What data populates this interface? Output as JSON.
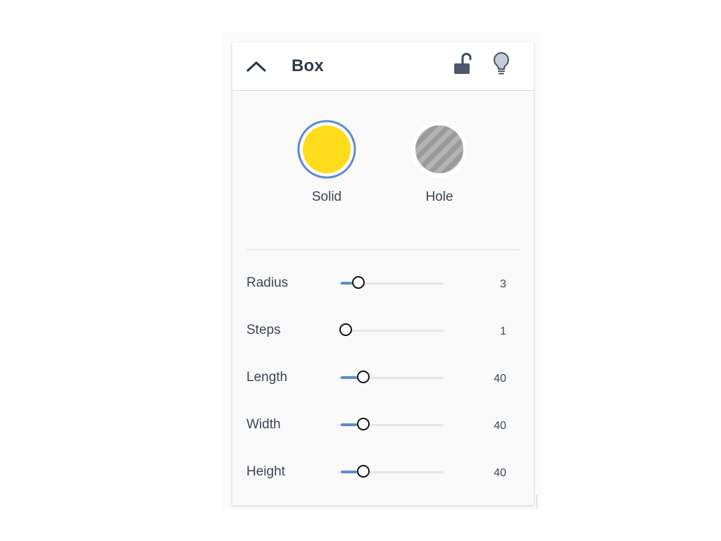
{
  "panel": {
    "title": "Box",
    "icons": {
      "collapse": "chevron-up-icon",
      "lock": "unlock-icon",
      "light": "lightbulb-icon"
    }
  },
  "shape_types": [
    {
      "label": "Solid",
      "selected": true,
      "color": "#ffdc1c"
    },
    {
      "label": "Hole",
      "selected": false,
      "color": "#a8a8a8"
    }
  ],
  "colors": {
    "accent": "#5c8ccf",
    "title": "#2b3a4d",
    "text": "#3b4654"
  },
  "params": [
    {
      "label": "Radius",
      "value": "3",
      "fill_fraction": 0.13
    },
    {
      "label": "Steps",
      "value": "1",
      "fill_fraction": 0.0
    },
    {
      "label": "Length",
      "value": "40",
      "fill_fraction": 0.18
    },
    {
      "label": "Width",
      "value": "40",
      "fill_fraction": 0.18
    },
    {
      "label": "Height",
      "value": "40",
      "fill_fraction": 0.18
    }
  ]
}
